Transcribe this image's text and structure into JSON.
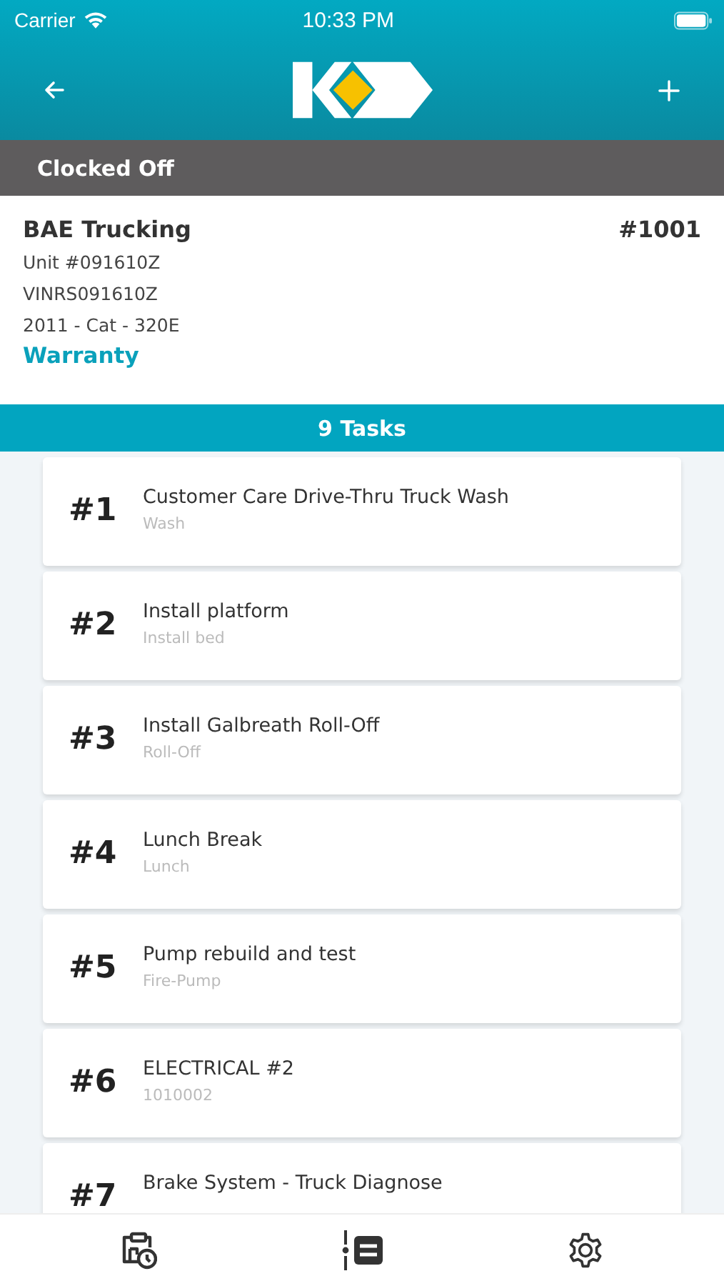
{
  "status_bar": {
    "carrier": "Carrier",
    "time": "10:33 PM"
  },
  "clock_status": "Clocked Off",
  "work_order": {
    "customer": "BAE Trucking",
    "number": "#1001",
    "unit": "Unit #091610Z",
    "vin": "VINRS091610Z",
    "equipment": "2011 - Cat - 320E",
    "type": "Warranty"
  },
  "tasks_header": "9 Tasks",
  "tasks": [
    {
      "number": "#1",
      "title": "Customer Care Drive-Thru Truck Wash",
      "subtitle": "Wash"
    },
    {
      "number": "#2",
      "title": "Install platform",
      "subtitle": "Install bed"
    },
    {
      "number": "#3",
      "title": "Install Galbreath Roll-Off",
      "subtitle": "Roll-Off"
    },
    {
      "number": "#4",
      "title": "Lunch Break",
      "subtitle": "Lunch"
    },
    {
      "number": "#5",
      "title": "Pump rebuild and test",
      "subtitle": "Fire-Pump"
    },
    {
      "number": "#6",
      "title": "ELECTRICAL #2",
      "subtitle": "1010002"
    },
    {
      "number": "#7",
      "title": "Brake System - Truck Diagnose"
    }
  ]
}
